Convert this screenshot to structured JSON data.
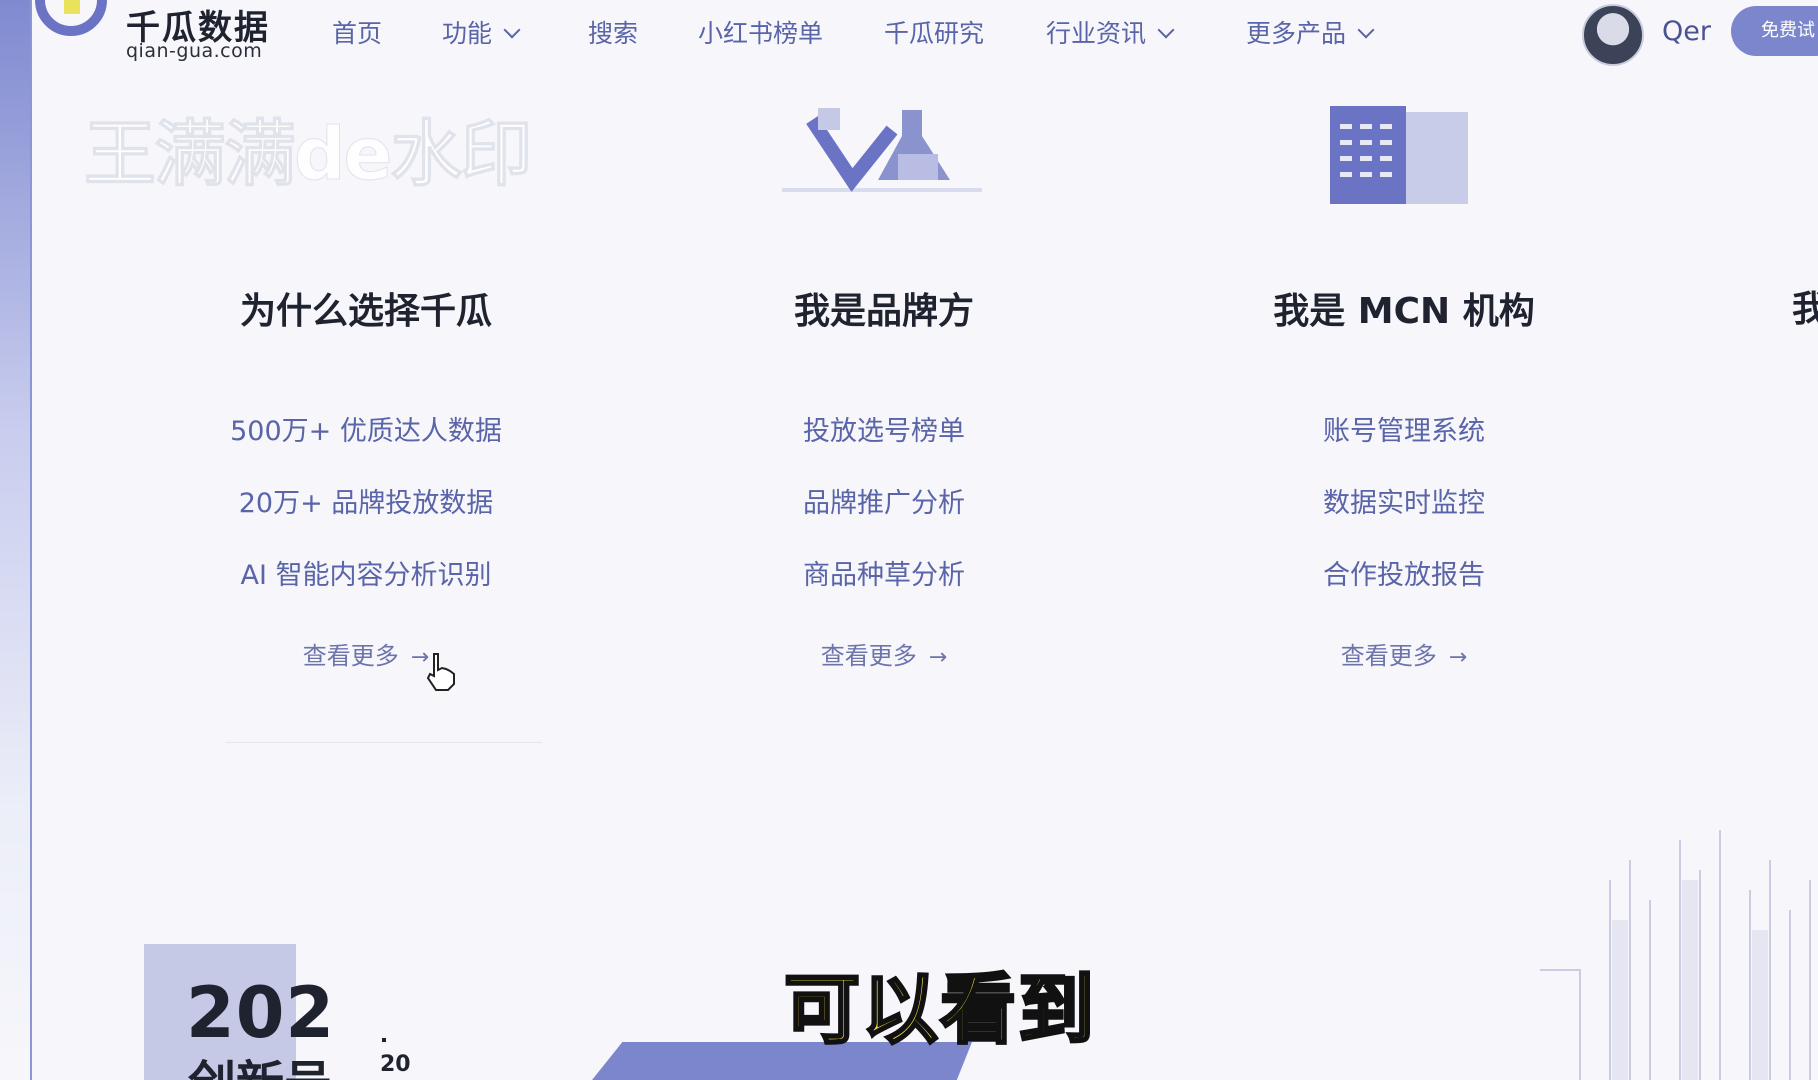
{
  "header": {
    "logo_title": "千瓜数据",
    "logo_domain": "qian-gua.com",
    "nav": [
      {
        "label": "首页"
      },
      {
        "label": "功能"
      },
      {
        "label": "搜索"
      },
      {
        "label": "小红书榜单"
      },
      {
        "label": "千瓜研究"
      },
      {
        "label": "行业资讯"
      },
      {
        "label": "更多产品"
      }
    ],
    "username": "Qer",
    "trial_button": "免费试"
  },
  "watermark": "王满满de水印",
  "columns": [
    {
      "title": "为什么选择千瓜",
      "features": [
        "500万+ 优质达人数据",
        "20万+ 品牌投放数据",
        "AI 智能内容分析识别"
      ],
      "more": "查看更多"
    },
    {
      "title": "我是品牌方",
      "features": [
        "投放选号榜单",
        "品牌推广分析",
        "商品种草分析"
      ],
      "more": "查看更多"
    },
    {
      "title": "我是 MCN 机构",
      "features": [
        "账号管理系统",
        "数据实时监控",
        "合作投放报告"
      ],
      "more": "查看更多"
    }
  ],
  "col4_title_partial": "我",
  "promo": {
    "year": "202",
    "subtitle": "创新号",
    "small": "20"
  },
  "caption": "可以看到",
  "colors": {
    "accent": "#7c86cc",
    "nav_text": "#5a64a8",
    "caption": "#f3e33a"
  }
}
